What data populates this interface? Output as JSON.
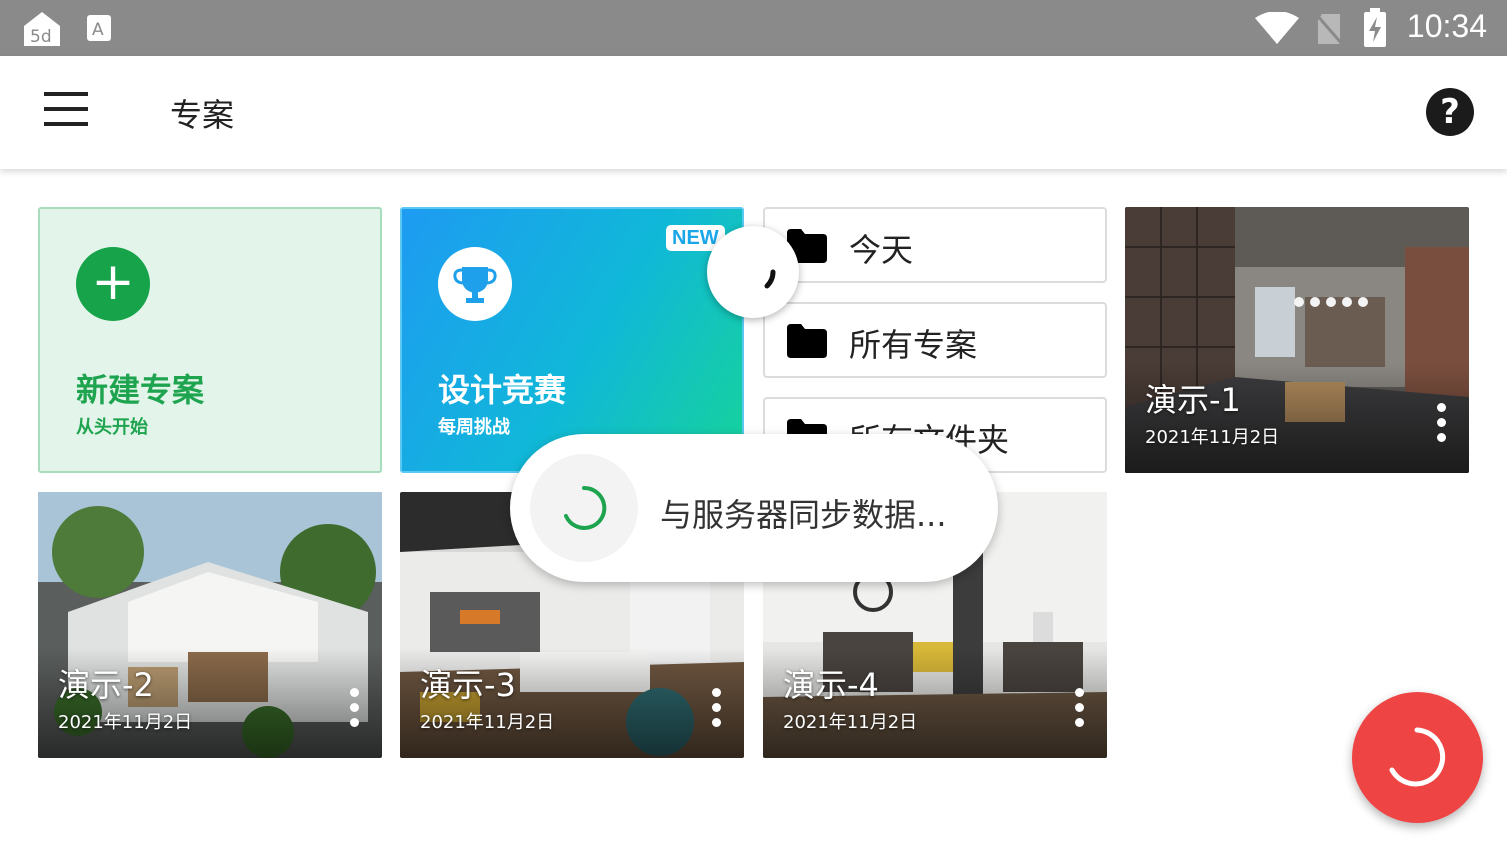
{
  "status_bar": {
    "time": "10:34",
    "icons": [
      "5d-app-icon",
      "a-text-icon",
      "wifi-icon",
      "no-sim-icon",
      "battery-charging-icon"
    ]
  },
  "toolbar": {
    "title": "专案",
    "menu_icon": "hamburger-menu-icon",
    "help_icon": "help-icon",
    "help_glyph": "?"
  },
  "new_project": {
    "plus": "+",
    "title": "新建专案",
    "subtitle": "从头开始"
  },
  "contest": {
    "badge": "NEW",
    "title": "设计竞赛",
    "subtitle": "每周挑战"
  },
  "folders": [
    {
      "label": "今天"
    },
    {
      "label": "所有专案"
    },
    {
      "label": "所有文件夹"
    }
  ],
  "projects": [
    {
      "name": "演示-1",
      "date": "2021年11月2日"
    },
    {
      "name": "演示-2",
      "date": "2021年11月2日"
    },
    {
      "name": "演示-3",
      "date": "2021年11月2日"
    },
    {
      "name": "演示-4",
      "date": "2021年11月2日"
    }
  ],
  "sync_toast": {
    "text": "与服务器同步数据..."
  },
  "colors": {
    "accent_green": "#16a34a",
    "fab_red": "#ef4444",
    "contest_blue": "#1e9bf2"
  }
}
